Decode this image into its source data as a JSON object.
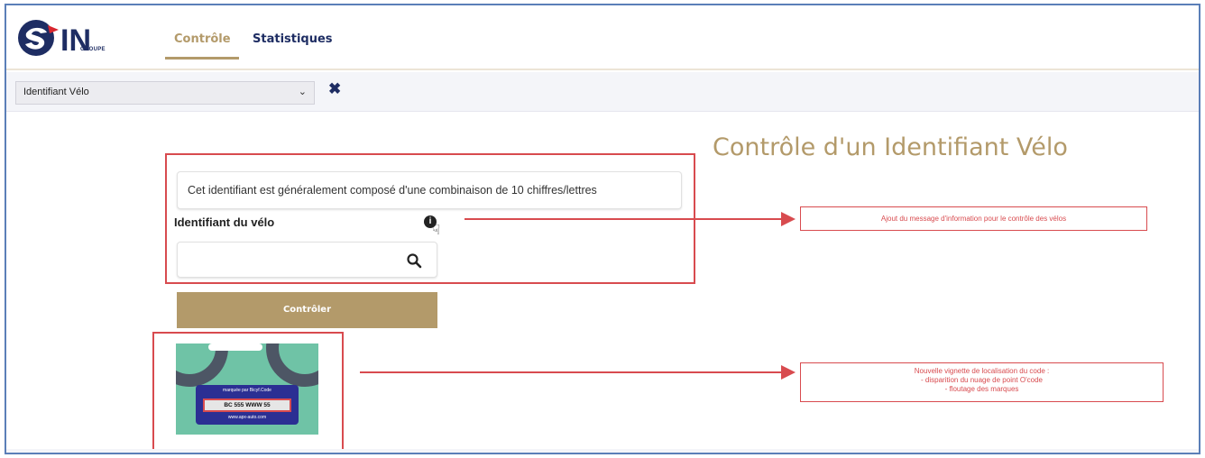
{
  "brand": {
    "logo_text": "IN",
    "logo_sub": "GROUPE"
  },
  "nav": {
    "tabs": [
      {
        "label": "Contrôle",
        "active": true
      },
      {
        "label": "Statistiques",
        "active": false
      }
    ]
  },
  "filter": {
    "selected": "Identifiant Vélo",
    "clear_icon": "close-icon"
  },
  "main": {
    "title": "Contrôle d'un Identifiant Vélo",
    "info_message": "Cet identifiant est généralement composé d'une combinaison de 10 chiffres/lettres",
    "field_label": "Identifiant du vélo",
    "info_icon": "i",
    "search_value": "",
    "submit_label": "Contrôler"
  },
  "thumbnail": {
    "plate_top": "marquée par  Bicyf.Code",
    "plate_code": "BC 555 WWW 55",
    "plate_bottom": "www.apx-auto.com"
  },
  "annotations": {
    "note1": "Ajout du message d'information pour le contrôle des vélos",
    "note2_lines": [
      "Nouvelle vignette de localisation du code :",
      "- disparition du nuage de point O'code",
      "- floutage des marques"
    ],
    "color": "#d84b4f"
  },
  "colors": {
    "accent": "#b39a6a",
    "navy": "#1e2d63",
    "annotation": "#d84b4f"
  }
}
